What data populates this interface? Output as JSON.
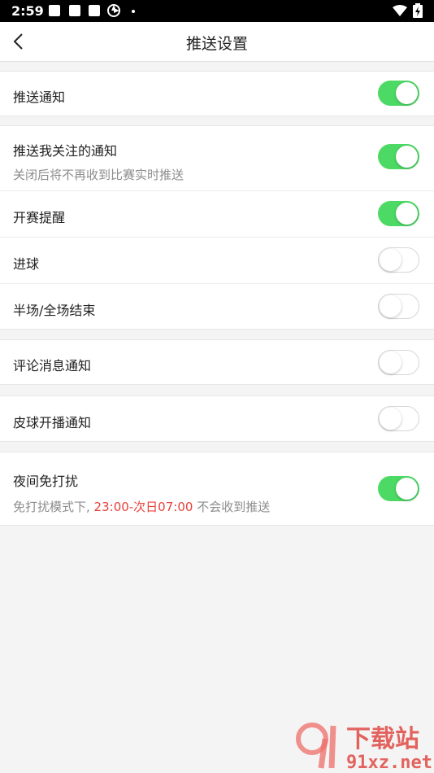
{
  "status_bar": {
    "time": "2:59"
  },
  "header": {
    "title": "推送设置"
  },
  "settings": {
    "push_notify": {
      "label": "推送通知",
      "enabled": true
    },
    "follow_notify": {
      "label": "推送我关注的通知",
      "desc": "关闭后将不再收到比赛实时推送",
      "enabled": true
    },
    "match_start": {
      "label": "开赛提醒",
      "enabled": true
    },
    "goal": {
      "label": "进球",
      "enabled": false
    },
    "half_full": {
      "label": "半场/全场结束",
      "enabled": false
    },
    "comment_notify": {
      "label": "评论消息通知",
      "enabled": false
    },
    "live_notify": {
      "label": "皮球开播通知",
      "enabled": false
    },
    "night_dnd": {
      "label": "夜间免打扰",
      "desc_prefix": "免打扰模式下, ",
      "desc_time": "23:00-次日07:00",
      "desc_suffix": " 不会收到推送",
      "enabled": true
    }
  },
  "colors": {
    "toggle_on": "#4cd964",
    "highlight": "#e8403a"
  },
  "watermark": {
    "text": "下载站",
    "domain": "91xz.net"
  }
}
